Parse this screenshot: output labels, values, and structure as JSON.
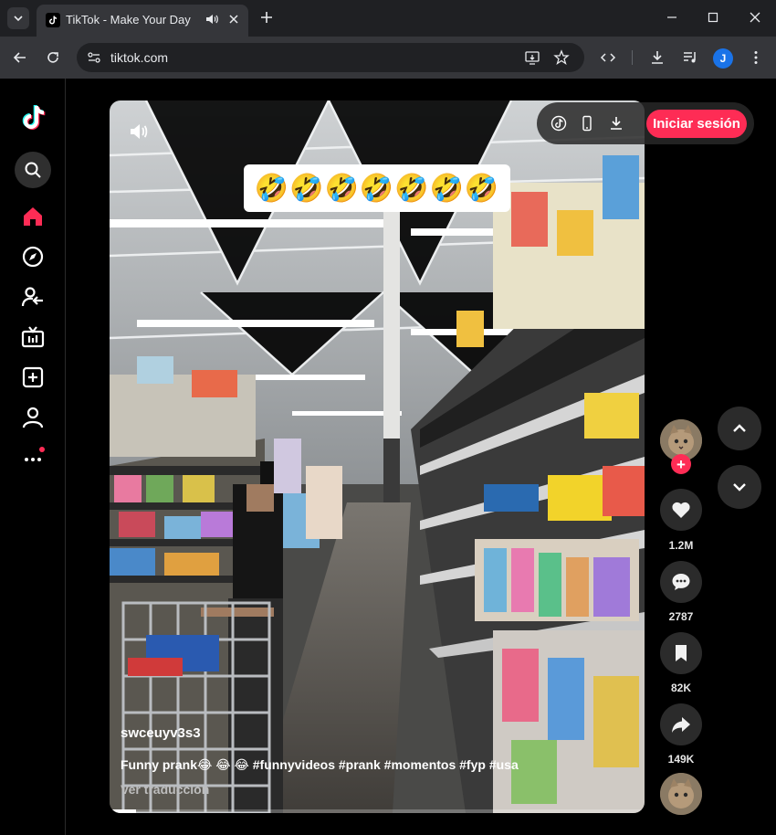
{
  "browser": {
    "tab_title": "TikTok - Make Your Day",
    "url": "tiktok.com",
    "profile_initial": "J"
  },
  "sidebar": {
    "items": [
      "home-icon",
      "explore-icon",
      "following-icon",
      "live-icon",
      "upload-icon",
      "profile-icon",
      "more-icon"
    ],
    "active_color": "#fe2c55"
  },
  "header": {
    "login_label": "Iniciar sesión"
  },
  "video": {
    "emoji_overlay": "🤣🤣🤣🤣🤣🤣🤣",
    "author": "swceuyv3s3",
    "caption": "Funny prank😂 😂 😂 #funnyvideos #prank #momentos #fyp #usa",
    "translate_label": "Ver traducción",
    "progress": 0.05
  },
  "actions": {
    "likes": "1.2M",
    "comments": "2787",
    "saves": "82K",
    "shares": "149K"
  },
  "colors": {
    "accent": "#fe2c55",
    "chrome_dark": "#1f2023",
    "chrome_toolbar": "#35363a"
  }
}
